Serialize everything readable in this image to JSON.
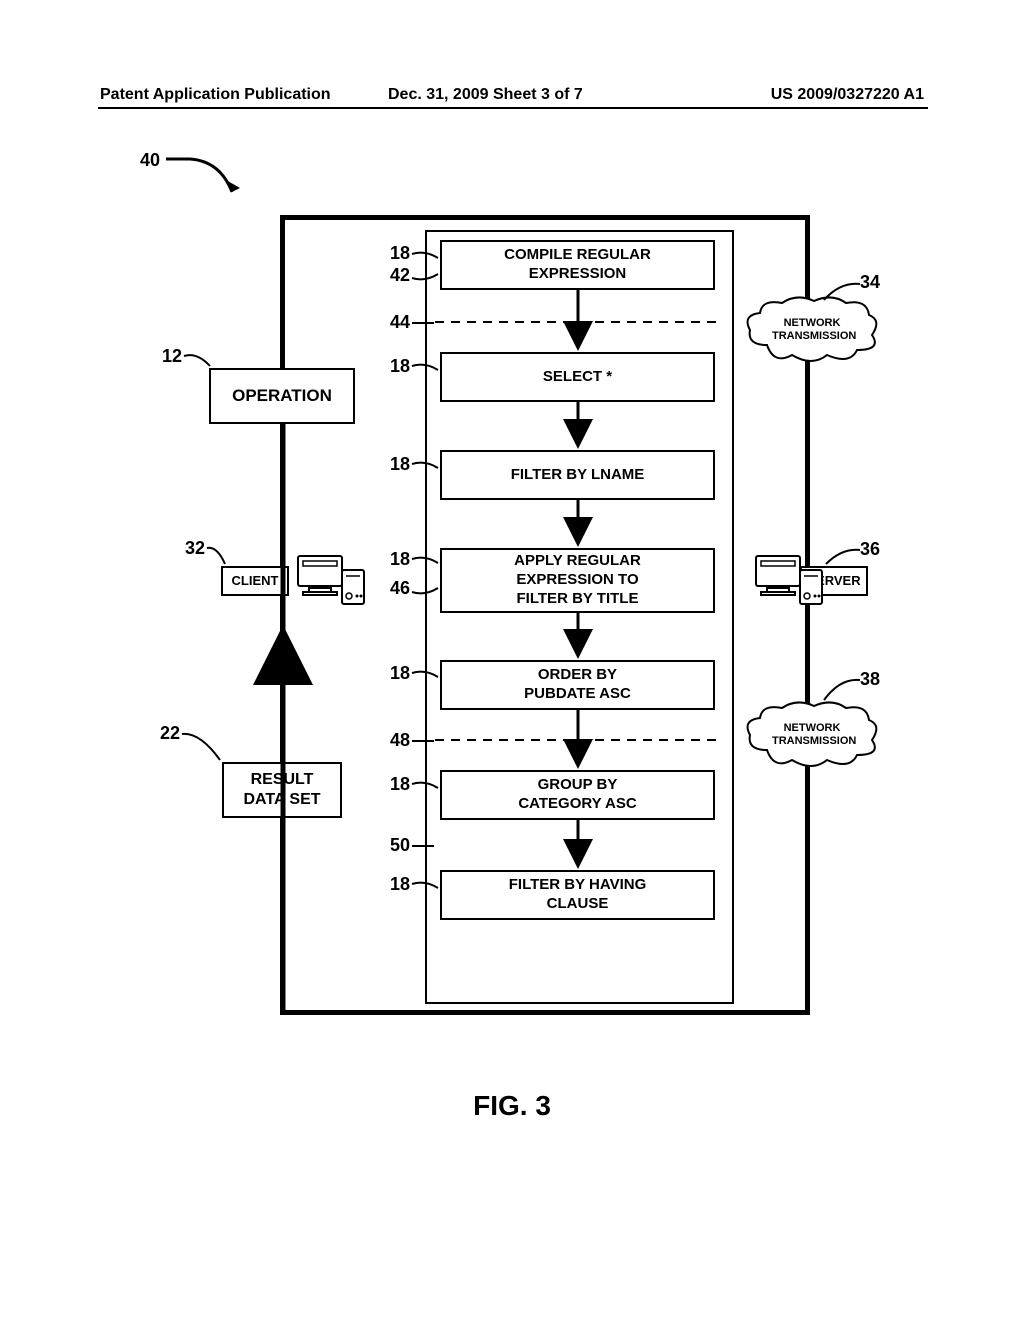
{
  "header": {
    "left": "Patent Application Publication",
    "mid": "Dec. 31, 2009  Sheet 3 of 7",
    "right": "US 2009/0327220 A1"
  },
  "figure_label": "FIG. 3",
  "refs": {
    "r40": "40",
    "r18a": "18",
    "r42": "42",
    "r44": "44",
    "r18b": "18",
    "r12": "12",
    "r18c": "18",
    "r32": "32",
    "r18d": "18",
    "r46": "46",
    "r18e": "18",
    "r48": "48",
    "r22": "22",
    "r18f": "18",
    "r50": "50",
    "r18g": "18",
    "r34": "34",
    "r36": "36",
    "r38": "38"
  },
  "boxes": {
    "operation": "OPERATION",
    "compile": "COMPILE REGULAR\nEXPRESSION",
    "select": "SELECT *",
    "filter_lname": "FILTER BY LNAME",
    "apply_regex": "APPLY REGULAR\nEXPRESSION TO\nFILTER BY TITLE",
    "orderby": "ORDER BY\nPUBDATE ASC",
    "groupby": "GROUP BY\nCATEGORY ASC",
    "filter_having": "FILTER BY HAVING\nCLAUSE",
    "result": "RESULT\nDATA SET",
    "client": "CLIENT",
    "server": "SERVER",
    "network1": "NETWORK\nTRANSMISSION",
    "network2": "NETWORK\nTRANSMISSION"
  }
}
